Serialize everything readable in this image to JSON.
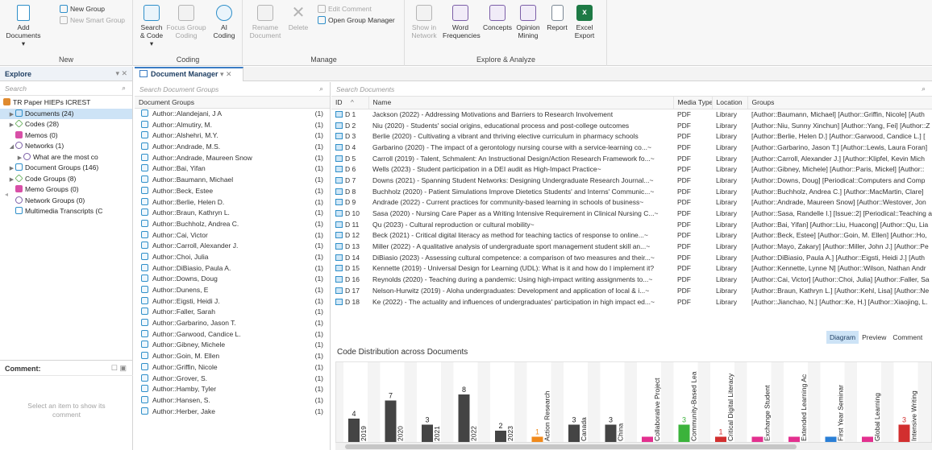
{
  "ribbon": {
    "groups": [
      {
        "label": "New"
      },
      {
        "label": "Coding"
      },
      {
        "label": "Manage"
      },
      {
        "label": "Explore & Analyze"
      }
    ],
    "add_documents": "Add\nDocuments ▾",
    "new_group": "New Group",
    "new_smart_group": "New Smart Group",
    "search_code": "Search\n& Code ▾",
    "focus_group": "Focus Group\nCoding",
    "ai_coding": "AI\nCoding",
    "rename_document": "Rename\nDocument",
    "delete": "Delete",
    "edit_comment": "Edit Comment",
    "open_group_manager": "Open Group Manager",
    "show_in_network": "Show in\nNetwork",
    "word_frequencies": "Word\nFrequencies",
    "concepts": "Concepts",
    "opinion_mining": "Opinion\nMining",
    "report": "Report",
    "excel_export": "Excel\nExport"
  },
  "explore": {
    "title": "Explore",
    "search_placeholder": "Search",
    "project": "TR Paper HIEPs ICREST",
    "items": [
      {
        "label": "Documents (24)"
      },
      {
        "label": "Codes (28)"
      },
      {
        "label": "Memos (0)"
      },
      {
        "label": "Networks (1)"
      },
      {
        "label": "What are the most co"
      },
      {
        "label": "Document Groups (146)"
      },
      {
        "label": "Code Groups (8)"
      },
      {
        "label": "Memo Groups (0)"
      },
      {
        "label": "Network Groups (0)"
      },
      {
        "label": "Multimedia Transcripts (C"
      }
    ]
  },
  "comment": {
    "title": "Comment:",
    "placeholder": "Select an item to show its comment"
  },
  "manager": {
    "tab_title": "Document Manager",
    "groups_search_placeholder": "Search Document Groups",
    "docs_search_placeholder": "Search Documents",
    "groups_header": "Document Groups",
    "groups": [
      {
        "name": "Author::Alandejani, J A",
        "count": "(1)"
      },
      {
        "name": "Author::Almutiry, M.",
        "count": "(1)"
      },
      {
        "name": "Author::Alshehri, M.Y.",
        "count": "(1)"
      },
      {
        "name": "Author::Andrade, M.S.",
        "count": "(1)"
      },
      {
        "name": "Author::Andrade, Maureen Snow",
        "count": "(1)"
      },
      {
        "name": "Author::Bai, Yifan",
        "count": "(1)"
      },
      {
        "name": "Author::Baumann, Michael",
        "count": "(1)"
      },
      {
        "name": "Author::Beck, Estee",
        "count": "(1)"
      },
      {
        "name": "Author::Berlie, Helen D.",
        "count": "(1)"
      },
      {
        "name": "Author::Braun, Kathryn L.",
        "count": "(1)"
      },
      {
        "name": "Author::Buchholz, Andrea C.",
        "count": "(1)"
      },
      {
        "name": "Author::Cai, Victor",
        "count": "(1)"
      },
      {
        "name": "Author::Carroll, Alexander J.",
        "count": "(1)"
      },
      {
        "name": "Author::Choi, Julia",
        "count": "(1)"
      },
      {
        "name": "Author::DiBiasio, Paula A.",
        "count": "(1)"
      },
      {
        "name": "Author::Downs, Doug",
        "count": "(1)"
      },
      {
        "name": "Author::Dunens, E",
        "count": "(1)"
      },
      {
        "name": "Author::Eigsti, Heidi J.",
        "count": "(1)"
      },
      {
        "name": "Author::Faller, Sarah",
        "count": "(1)"
      },
      {
        "name": "Author::Garbarino, Jason T.",
        "count": "(1)"
      },
      {
        "name": "Author::Garwood, Candice L.",
        "count": "(1)"
      },
      {
        "name": "Author::Gibney, Michele",
        "count": "(1)"
      },
      {
        "name": "Author::Goin, M. Ellen",
        "count": "(1)"
      },
      {
        "name": "Author::Griffin, Nicole",
        "count": "(1)"
      },
      {
        "name": "Author::Grover, S.",
        "count": "(1)"
      },
      {
        "name": "Author::Hamby, Tyler",
        "count": "(1)"
      },
      {
        "name": "Author::Hansen, S.",
        "count": "(1)"
      },
      {
        "name": "Author::Herber, Jake",
        "count": "(1)"
      }
    ],
    "columns": {
      "id": "ID",
      "sort": "^",
      "name": "Name",
      "media": "Media Type",
      "location": "Location",
      "groups": "Groups"
    },
    "documents": [
      {
        "id": "D 1",
        "name": "Jackson (2022) - Addressing Motivations and Barriers to Research Involvement",
        "media": "PDF",
        "location": "Library",
        "groups": "[Author::Baumann, Michael] [Author::Griffin, Nicole] [Auth"
      },
      {
        "id": "D 2",
        "name": "Niu (2020) - Students' social origins, educational process and post-college outcomes",
        "media": "PDF",
        "location": "Library",
        "groups": "[Author::Niu, Sunny Xinchun] [Author::Yang, Fei] [Author::Z"
      },
      {
        "id": "D 3",
        "name": "Berlie (2020) - Cultivating a vibrant and thriving elective curriculum in pharmacy schools",
        "media": "PDF",
        "location": "Library",
        "groups": "[Author::Berlie, Helen D.] [Author::Garwood, Candice L.] ["
      },
      {
        "id": "D 4",
        "name": "Garbarino (2020) - The impact of a gerontology nursing course with a service-learning co...~",
        "media": "PDF",
        "location": "Library",
        "groups": "[Author::Garbarino, Jason T.] [Author::Lewis, Laura Foran]"
      },
      {
        "id": "D 5",
        "name": "Carroll (2019) - Talent, Schmalent: An Instructional Design/Action Research Framework fo...~",
        "media": "PDF",
        "location": "Library",
        "groups": "[Author::Carroll, Alexander J.] [Author::Klipfel, Kevin Mich"
      },
      {
        "id": "D 6",
        "name": "Wells (2023) - Student participation in a DEI audit as High-Impact Practice~",
        "media": "PDF",
        "location": "Library",
        "groups": "[Author::Gibney, Michele] [Author::Paris, Mickel] [Author::"
      },
      {
        "id": "D 7",
        "name": "Downs (2021) - Spanning Student Networks: Designing Undergraduate Research Journal...~",
        "media": "PDF",
        "location": "Library",
        "groups": "[Author::Downs, Doug] [Periodical::Computers and Comp"
      },
      {
        "id": "D 8",
        "name": "Buchholz (2020) - Patient Simulations Improve Dietetics Students' and Interns' Communic...~",
        "media": "PDF",
        "location": "Library",
        "groups": "[Author::Buchholz, Andrea C.] [Author::MacMartin, Clare]"
      },
      {
        "id": "D 9",
        "name": "Andrade (2022) - Current practices for community-based learning in schools of business~",
        "media": "PDF",
        "location": "Library",
        "groups": "[Author::Andrade, Maureen Snow] [Author::Westover, Jon"
      },
      {
        "id": "D 10",
        "name": "Sasa (2020) - Nursing Care Paper as a Writing Intensive Requirement in Clinical Nursing C...~",
        "media": "PDF",
        "location": "Library",
        "groups": "[Author::Sasa, Randelle I.] [Issue::2] [Periodical::Teaching a"
      },
      {
        "id": "D 11",
        "name": "Qu (2023) - Cultural reproduction or cultural mobility~",
        "media": "PDF",
        "location": "Library",
        "groups": "[Author::Bai, Yifan] [Author::Liu, Huacong] [Author::Qu, Lia"
      },
      {
        "id": "D 12",
        "name": "Beck (2021) - Critical digital literacy as method for teaching tactics of response to online...~",
        "media": "PDF",
        "location": "Library",
        "groups": "[Author::Beck, Estee] [Author::Goin, M. Ellen] [Author::Ho,"
      },
      {
        "id": "D 13",
        "name": "Miller (2022) - A qualitative analysis of undergraduate sport management student skill an...~",
        "media": "PDF",
        "location": "Library",
        "groups": "[Author::Mayo, Zakary] [Author::Miller, John J.] [Author::Pe"
      },
      {
        "id": "D 14",
        "name": "DiBiasio (2023) - Assessing cultural competence: a comparison of two measures and their...~",
        "media": "PDF",
        "location": "Library",
        "groups": "[Author::DiBiasio, Paula A.] [Author::Eigsti, Heidi J.] [Auth"
      },
      {
        "id": "D 15",
        "name": "Kennette (2019) - Universal Design for Learning (UDL): What is it and how do I implement it?",
        "media": "PDF",
        "location": "Library",
        "groups": "[Author::Kennette, Lynne N] [Author::Wilson, Nathan Andr"
      },
      {
        "id": "D 16",
        "name": "Reynolds (2020) - Teaching during a pandemic: Using high-impact writing assignments to...~",
        "media": "PDF",
        "location": "Library",
        "groups": "[Author::Cai, Victor] [Author::Choi, Julia] [Author::Faller, Sa"
      },
      {
        "id": "D 17",
        "name": "Nelson-Hurwitz (2019) - Aloha undergraduates: Development and application of local & i...~",
        "media": "PDF",
        "location": "Library",
        "groups": "[Author::Braun, Kathryn L.] [Author::Kehl, Lisa] [Author::Ne"
      },
      {
        "id": "D 18",
        "name": "Ke (2022) - The actuality and influences of undergraduates' participation in high impact ed...~",
        "media": "PDF",
        "location": "Library",
        "groups": "[Author::Jianchao, N.] [Author::Ke, H.] [Author::Xiaojing, L."
      }
    ],
    "view_tabs": [
      "Diagram",
      "Preview",
      "Comment"
    ]
  },
  "chart_data": {
    "type": "bar",
    "title": "Code Distribution across Documents",
    "categories": [
      "2019",
      "2020",
      "2021",
      "2022",
      "2023",
      "Action Research",
      "Canada",
      "China",
      "Collaborative Project",
      "Community-Based Lea",
      "Critical Digital Literacy",
      "Exchange Student",
      "Extended Learning Ac",
      "First Year Seminar",
      "Global Learning",
      "Intensive Writing"
    ],
    "values": [
      4,
      7,
      3,
      8,
      2,
      1,
      3,
      3,
      1,
      3,
      1,
      1,
      1,
      1,
      1,
      3
    ],
    "value_labels": [
      "4",
      "7",
      "3",
      "8",
      "2",
      "1",
      "3",
      "3",
      "",
      "3",
      "1",
      "",
      "",
      "",
      "",
      "3"
    ],
    "colors": [
      "#444444",
      "#444444",
      "#444444",
      "#444444",
      "#444444",
      "#f08a1c",
      "#444444",
      "#444444",
      "#e3308f",
      "#3bb33b",
      "#d22f2f",
      "#e3308f",
      "#e3308f",
      "#2a7fd6",
      "#e3308f",
      "#d22f2f"
    ],
    "ylim": [
      0,
      8
    ]
  }
}
